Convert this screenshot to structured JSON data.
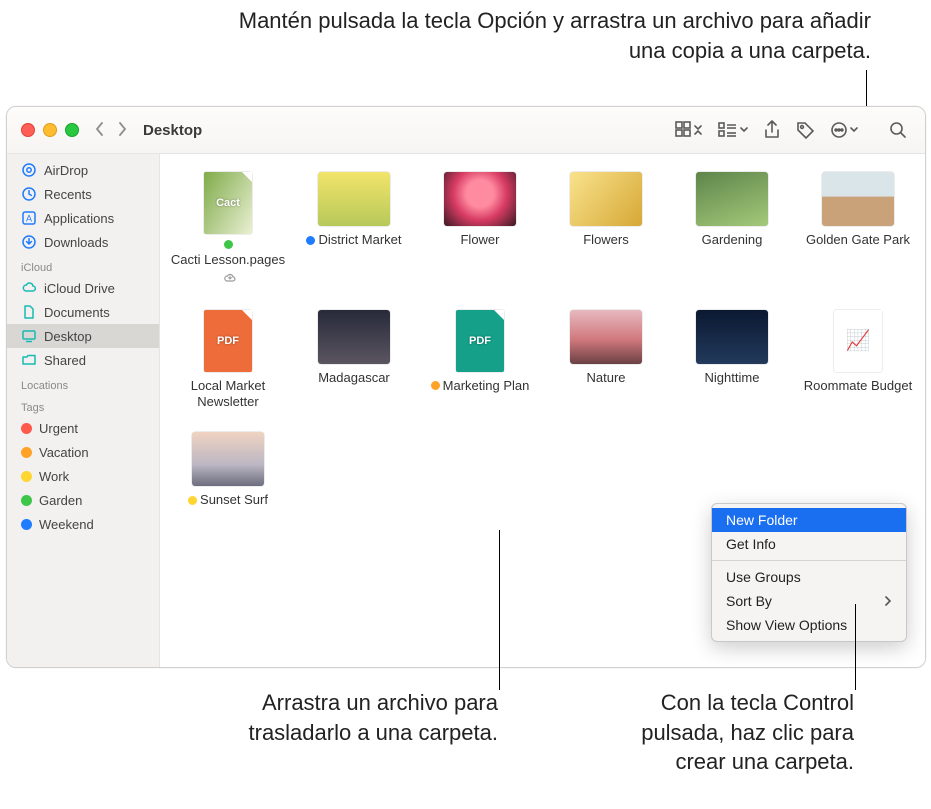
{
  "callouts": {
    "top": "Mantén pulsada la tecla Opción y arrastra un archivo para añadir una copia a una carpeta.",
    "bottom_left": "Arrastra un archivo para trasladarlo a una carpeta.",
    "bottom_right": "Con la tecla Control pulsada, haz clic para crear una carpeta."
  },
  "window": {
    "title": "Desktop"
  },
  "sidebar": {
    "favorites": [
      {
        "label": "AirDrop"
      },
      {
        "label": "Recents"
      },
      {
        "label": "Applications"
      },
      {
        "label": "Downloads"
      }
    ],
    "icloud_header": "iCloud",
    "icloud": [
      {
        "label": "iCloud Drive"
      },
      {
        "label": "Documents"
      },
      {
        "label": "Desktop",
        "active": true
      },
      {
        "label": "Shared"
      }
    ],
    "locations_header": "Locations",
    "tags_header": "Tags",
    "tags": [
      {
        "label": "Urgent",
        "color": "#ff5b4c"
      },
      {
        "label": "Vacation",
        "color": "#ffa228"
      },
      {
        "label": "Work",
        "color": "#ffd531"
      },
      {
        "label": "Garden",
        "color": "#3ec648"
      },
      {
        "label": "Weekend",
        "color": "#1f7cff"
      }
    ]
  },
  "files": [
    {
      "label": "Cacti Lesson.pages",
      "tag": "#3ec648",
      "cloud": true,
      "type": "doc",
      "bg": "linear-gradient(120deg,#7fab4a,#eaf0d3)",
      "text": "Cact"
    },
    {
      "label": "District Market",
      "tag": "#1f7cff",
      "type": "photo",
      "bg": "linear-gradient(180deg,#f2e46a,#b7c95a)",
      "text": ""
    },
    {
      "label": "Flower",
      "type": "photo",
      "bg": "radial-gradient(circle at 50% 40%,#ff8ba0 28%,#d73b63 55%,#3a1a23)"
    },
    {
      "label": "Flowers",
      "type": "photo",
      "bg": "linear-gradient(130deg,#f9e28c,#d6a836)"
    },
    {
      "label": "Gardening",
      "type": "photo",
      "bg": "linear-gradient(160deg,#5d854a,#a4c97a)"
    },
    {
      "label": "Golden Gate Park",
      "type": "photo",
      "bg": "linear-gradient(180deg,#d9e5e8 45%,#caa27a 46%)"
    },
    {
      "label": "Local Market Newsletter",
      "type": "doc",
      "bg": "#ee6c3a",
      "text": "PDF"
    },
    {
      "label": "Madagascar",
      "type": "photo",
      "bg": "linear-gradient(180deg,#272a39,#5b5561)"
    },
    {
      "label": "Marketing Plan",
      "tag": "#ffa228",
      "type": "doc",
      "bg": "#14a089",
      "text": "PDF"
    },
    {
      "label": "Nature",
      "type": "photo",
      "bg": "linear-gradient(180deg,#e7b9bf,#d0787d 55%,#6b4043)"
    },
    {
      "label": "Nighttime",
      "type": "photo",
      "bg": "linear-gradient(180deg,#0b1831,#223a5c)"
    },
    {
      "label": "Roommate Budget",
      "type": "doc",
      "bg": "#ffffff",
      "text": "📈"
    },
    {
      "label": "Sunset Surf",
      "tag": "#ffd531",
      "type": "photo",
      "bg": "linear-gradient(180deg,#f0d3c1,#bcb7c3 60%,#6c6d7e)"
    }
  ],
  "context_menu": {
    "items": [
      {
        "label": "New Folder",
        "selected": true
      },
      {
        "label": "Get Info"
      },
      {
        "sep": true
      },
      {
        "label": "Use Groups"
      },
      {
        "label": "Sort By",
        "submenu": true
      },
      {
        "label": "Show View Options"
      }
    ]
  }
}
